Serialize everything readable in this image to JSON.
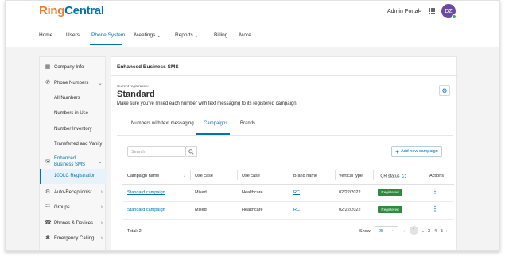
{
  "header": {
    "logo_ring": "Ring",
    "logo_central": "Central",
    "admin_portal": "Admin Portal",
    "avatar_initials": "DZ",
    "colors": {
      "accent": "#0073ae",
      "logo_orange": "#f47920",
      "avatar": "#6d4aa0",
      "status_green": "#36b34a"
    }
  },
  "nav": {
    "items": [
      "Home",
      "Users",
      "Phone System",
      "Meetings",
      "Reports",
      "Billing",
      "More"
    ],
    "active": "Phone System"
  },
  "sidebar": {
    "items": [
      {
        "label": "Company Info",
        "icon": "building-icon"
      },
      {
        "label": "Phone Numbers",
        "icon": "phone-icon"
      },
      {
        "label": "All Numbers"
      },
      {
        "label": "Numbers in Use"
      },
      {
        "label": "Number Inventory"
      },
      {
        "label": "Transferred and Vanity"
      },
      {
        "label": "Enhanced Business SMS",
        "icon": "message-icon"
      },
      {
        "label": "10DLC Registration"
      },
      {
        "label": "Auto-Receptionist",
        "icon": "auto-receptionist-icon"
      },
      {
        "label": "Groups",
        "icon": "groups-icon"
      },
      {
        "label": "Phones & Devices",
        "icon": "devices-icon"
      },
      {
        "label": "Emergency Calling",
        "icon": "emergency-icon"
      }
    ]
  },
  "main": {
    "title": "Enhanced Business SMS",
    "current_registration_label": "Current registration:",
    "current_registration_value": "Standard",
    "description": "Make sure you've linked each number with text messaging to its registered campaign.",
    "tabs": [
      "Numbers with text messaging",
      "Campaigns",
      "Brands"
    ],
    "active_tab": "Campaigns",
    "search_placeholder": "Search",
    "add_button": "Add new campaign"
  },
  "table": {
    "headers": [
      "Campaign name",
      "Use case",
      "Use case",
      "Brand name",
      "Vertical type",
      "TCR status",
      "Actions"
    ],
    "rows": [
      {
        "campaign": "Standard campaign",
        "use_case_1": "Mixed",
        "use_case_2": "Healthcare",
        "brand": "RC",
        "vertical": "02/22/2022",
        "status": "Registered"
      },
      {
        "campaign": "Standard campaign",
        "use_case_1": "Mixed",
        "use_case_2": "Healthcare",
        "brand": "RC",
        "vertical": "02/22/2022",
        "status": "Registered"
      }
    ]
  },
  "footer": {
    "total": "Total: 2",
    "show_label": "Show:",
    "page_size": "25",
    "pages": [
      "1",
      "...",
      "3",
      "4",
      "5"
    ],
    "current_page": "1"
  }
}
